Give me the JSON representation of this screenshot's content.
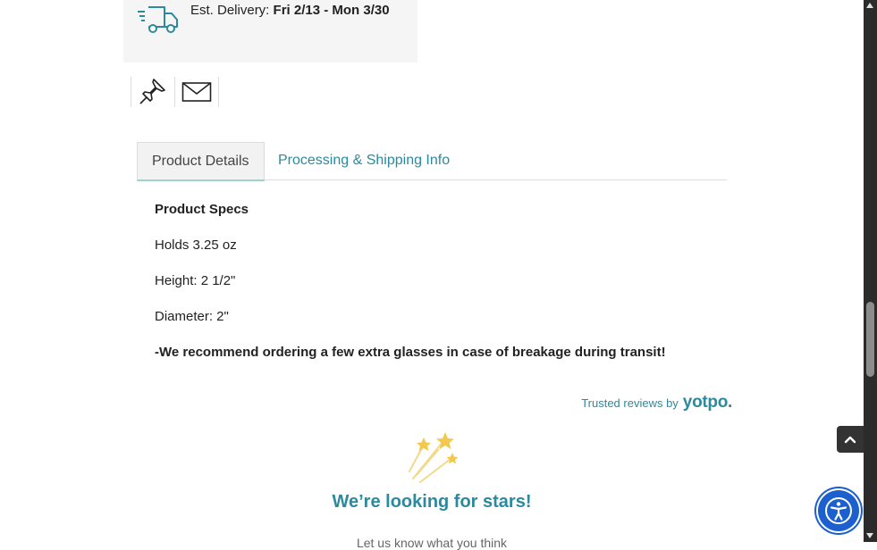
{
  "delivery": {
    "label": "Est. Delivery:",
    "dates": "Fri 2/13 - Mon 3/30",
    "icon": "delivery-truck-icon"
  },
  "share": {
    "pin_icon": "pushpin-icon",
    "email_icon": "envelope-icon"
  },
  "tabs": [
    {
      "label": "Product Details",
      "active": true
    },
    {
      "label": "Processing & Shipping Info",
      "active": false
    }
  ],
  "specs": {
    "heading": "Product Specs",
    "lines": [
      "Holds 3.25 oz",
      "Height: 2 1/2\"",
      "Diameter: 2\""
    ],
    "note": "-We recommend ordering a few extra glasses in case of breakage during transit!"
  },
  "reviews": {
    "trusted_label": "Trusted reviews by",
    "brand": "yotpo.",
    "empty_title": "We’re looking for stars!",
    "empty_sub": "Let us know what you think"
  },
  "colors": {
    "accent": "#2b8a9d",
    "a11y_button": "#1c5fcf"
  }
}
